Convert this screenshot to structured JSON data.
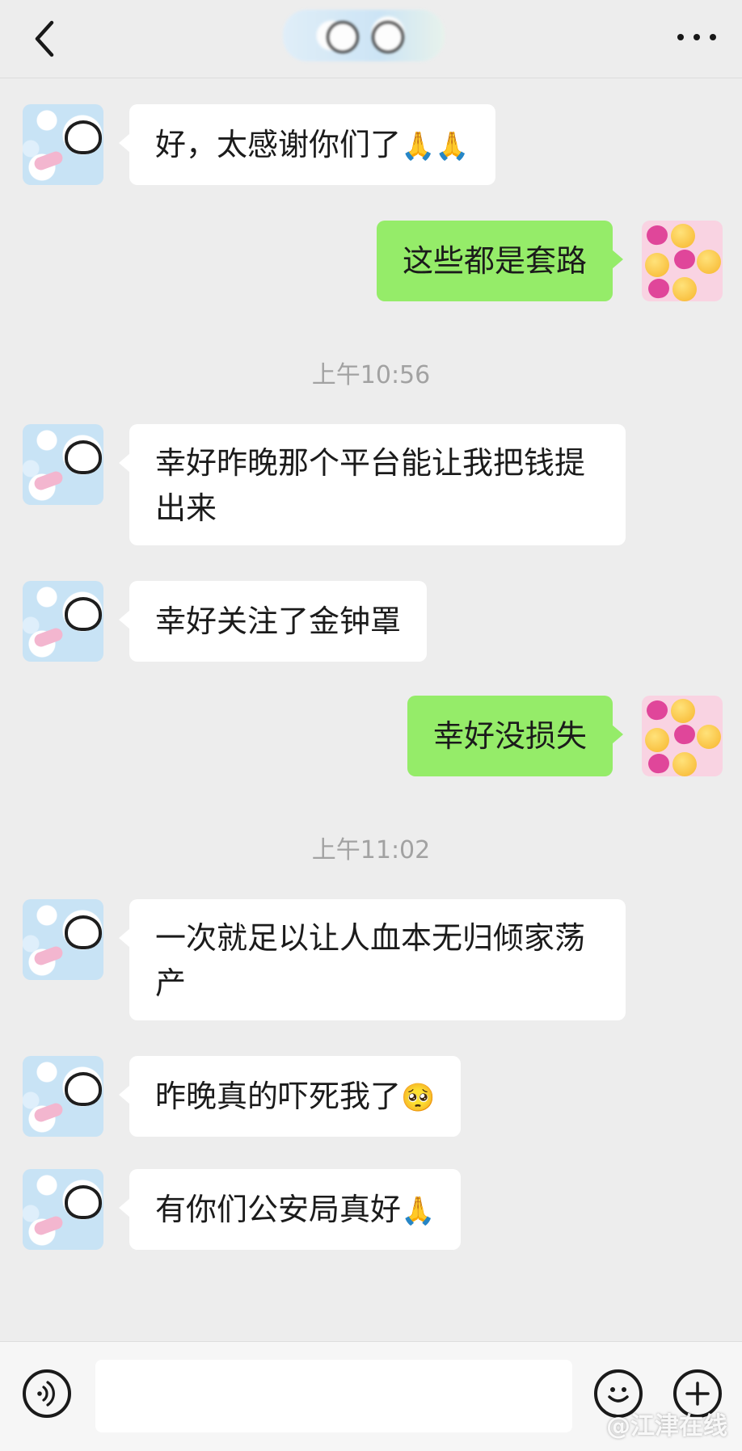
{
  "header": {
    "back_icon": "chevron-left-icon",
    "more_icon": "more-dots-icon",
    "contact_name_blurred": true
  },
  "messages": [
    {
      "side": "in",
      "text": "好，太感谢你们了",
      "emoji": "🙏🙏"
    },
    {
      "side": "out",
      "text": "这些都是套路",
      "emoji": ""
    },
    {
      "type": "time",
      "text": "上午10:56"
    },
    {
      "side": "in",
      "text": "幸好昨晚那个平台能让我把钱提出来",
      "emoji": ""
    },
    {
      "side": "in",
      "text": "幸好关注了金钟罩",
      "emoji": ""
    },
    {
      "side": "out",
      "text": "幸好没损失",
      "emoji": ""
    },
    {
      "type": "time",
      "text": "上午11:02"
    },
    {
      "side": "in",
      "text": "一次就足以让人血本无归倾家荡产",
      "emoji": ""
    },
    {
      "side": "in",
      "text": "昨晚真的吓死我了",
      "emoji": "🥺"
    },
    {
      "side": "in",
      "text": "有你们公安局真好",
      "emoji": "🙏"
    }
  ],
  "bottom_bar": {
    "voice_icon": "voice-icon",
    "emoji_icon": "emoji-smile-icon",
    "plus_icon": "plus-icon",
    "input_value": ""
  },
  "watermark": "@江津在线",
  "colors": {
    "background": "#ededed",
    "outgoing_bubble": "#95ec69",
    "incoming_bubble": "#ffffff",
    "timestamp": "#a2a2a2"
  }
}
